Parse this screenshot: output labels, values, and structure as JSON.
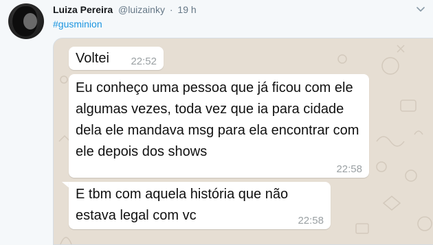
{
  "tweet": {
    "display_name": "Luiza Pereira",
    "handle": "@luizainky",
    "separator": "·",
    "time": "19 h",
    "hashtag": "#gusminion"
  },
  "chat": {
    "messages": [
      {
        "text": "Voltei",
        "time": "22:52"
      },
      {
        "text": "Eu conheço uma pessoa que já ficou com ele algumas vezes, toda vez que ia para cidade dela ele mandava msg para ela encontrar com ele depois dos shows",
        "time": "22:58"
      },
      {
        "text": "E tbm com aquela história que não estava legal com vc",
        "time": "22:58"
      }
    ]
  },
  "colors": {
    "hashtag": "#1b95e0",
    "chat_background": "#e6ded3",
    "bubble": "#ffffff",
    "timestamp": "#9aa0a3"
  },
  "icons": {
    "menu": "chevron-down-icon",
    "avatar": "profile-photo"
  }
}
